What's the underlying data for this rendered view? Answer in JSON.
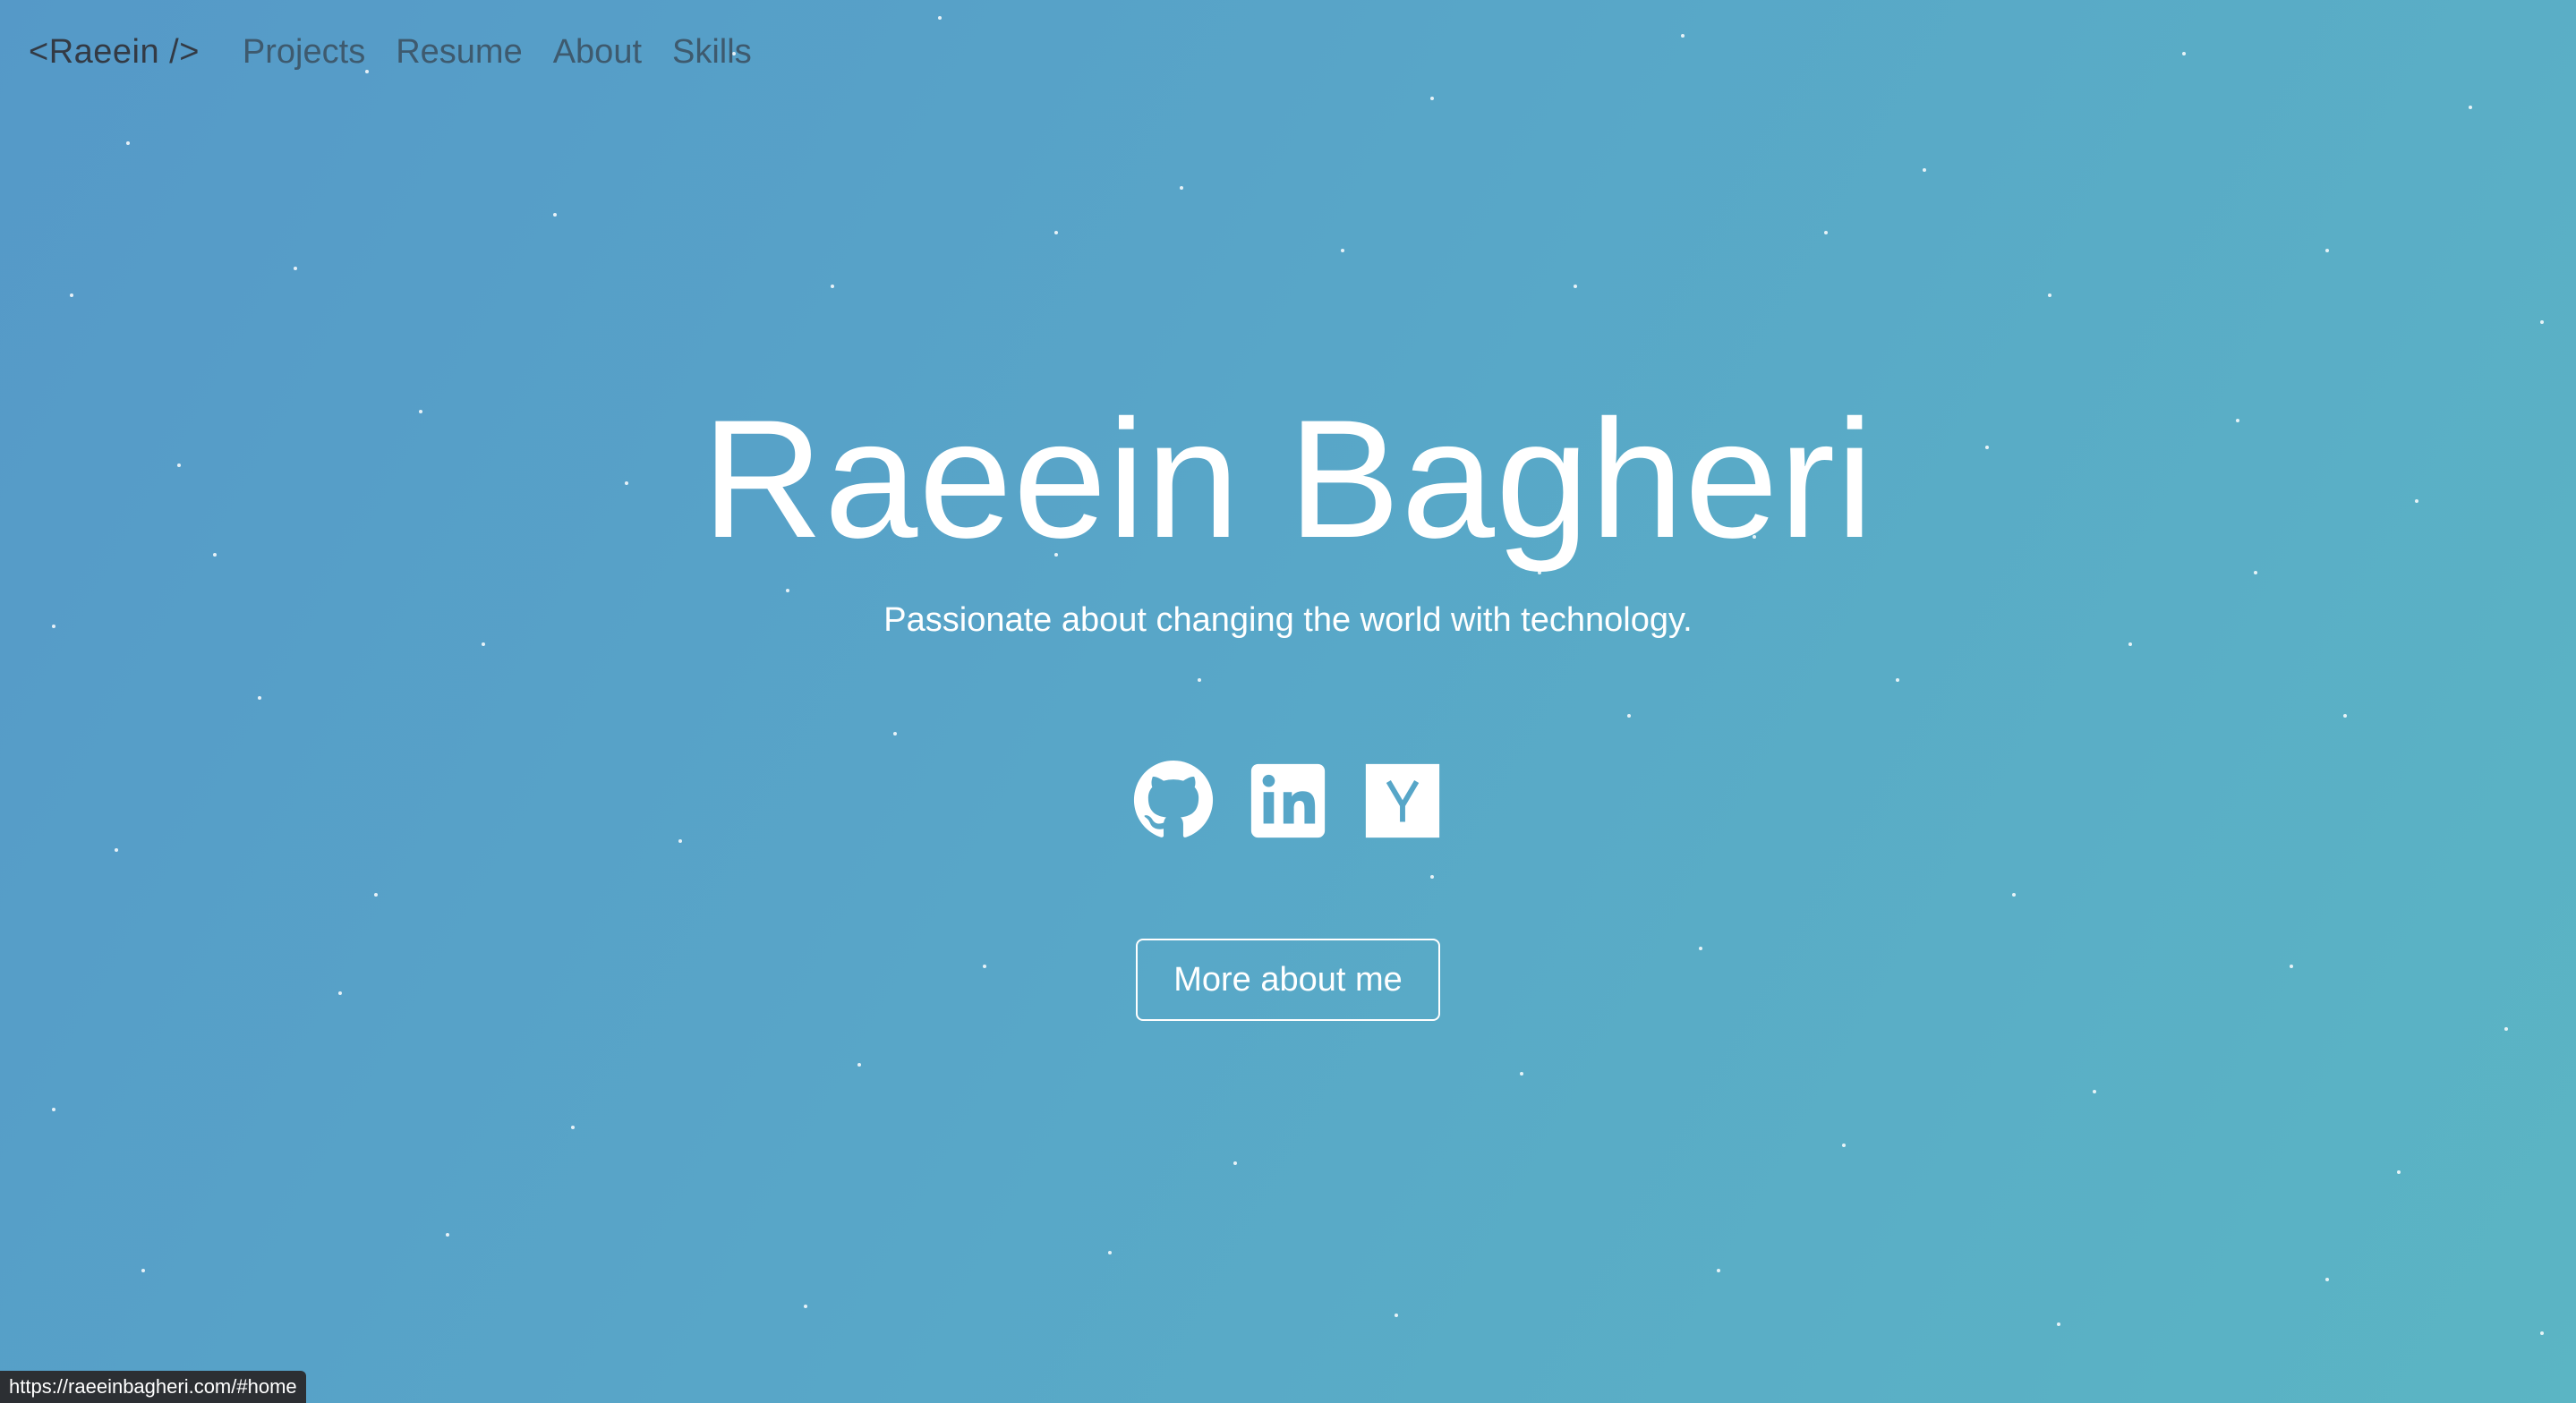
{
  "nav": {
    "brand": "<Raeein />",
    "links": [
      "Projects",
      "Resume",
      "About",
      "Skills"
    ]
  },
  "hero": {
    "title": "Raeein Bagheri",
    "subtitle": "Passionate about changing the world with technology."
  },
  "socials": [
    {
      "name": "github-icon"
    },
    {
      "name": "linkedin-icon"
    },
    {
      "name": "ycombinator-icon"
    }
  ],
  "cta": {
    "label": "More about me"
  },
  "statusbar": {
    "url": "https://raeeinbagheri.com/#home"
  },
  "colors": {
    "background_start": "#5599c8",
    "background_end": "#5bb5c4",
    "nav_brand": "#333a44",
    "nav_link": "#3e5a6e",
    "text": "#ffffff"
  }
}
